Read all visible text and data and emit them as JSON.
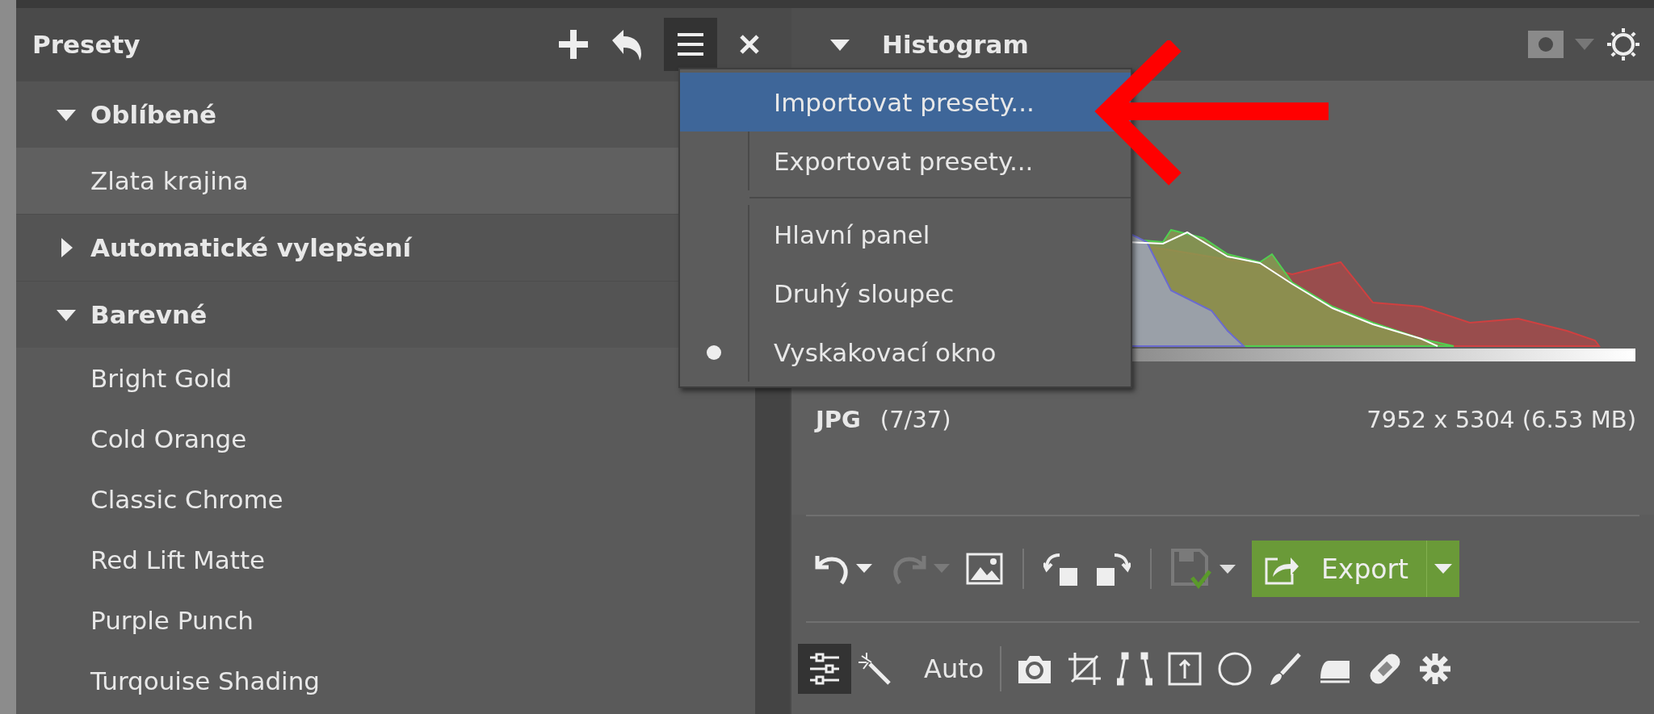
{
  "presets_panel": {
    "title": "Presety",
    "tree": [
      {
        "label": "Oblíbené",
        "expanded": true,
        "children": [
          {
            "label": "Zlata krajina"
          }
        ]
      },
      {
        "label": "Automatické vylepšení",
        "expanded": false
      },
      {
        "label": "Barevné",
        "expanded": true,
        "children": [
          {
            "label": "Bright Gold"
          },
          {
            "label": "Cold Orange"
          },
          {
            "label": "Classic Chrome"
          },
          {
            "label": "Red Lift Matte"
          },
          {
            "label": "Purple Punch"
          },
          {
            "label": "Turqouise Shading"
          }
        ]
      }
    ]
  },
  "menu": {
    "open": true,
    "groups": [
      [
        {
          "label": "Importovat presety...",
          "highlighted": true,
          "selected": false
        },
        {
          "label": "Exportovat presety...",
          "highlighted": false,
          "selected": false
        }
      ],
      [
        {
          "label": "Hlavní panel",
          "highlighted": false,
          "selected": false
        },
        {
          "label": "Druhý sloupec",
          "highlighted": false,
          "selected": false
        },
        {
          "label": "Vyskakovací okno",
          "highlighted": false,
          "selected": true
        }
      ]
    ]
  },
  "histogram_panel": {
    "title": "Histogram",
    "expanded": true,
    "format": "JPG",
    "position": "(7/37)",
    "dimensions": "7952 x 5304 (6.53 MB)"
  },
  "toolbar": [
    {
      "kind": "undo",
      "disabled": false
    },
    {
      "kind": "redo",
      "disabled": true
    },
    {
      "kind": "image",
      "disabled": false
    },
    {
      "kind": "rotate-left",
      "disabled": false
    },
    {
      "kind": "rotate-right",
      "disabled": false
    },
    {
      "kind": "save",
      "disabled": true
    }
  ],
  "export_button": {
    "label": "Export"
  },
  "tools": {
    "auto_label": "Auto",
    "items": [
      {
        "kind": "adjust",
        "selected": true
      },
      {
        "kind": "wand",
        "selected": false
      },
      {
        "kind": "camera",
        "selected": false
      },
      {
        "kind": "crop",
        "selected": false
      },
      {
        "kind": "perspective",
        "selected": false
      },
      {
        "kind": "upload",
        "selected": false
      },
      {
        "kind": "circle",
        "selected": false
      },
      {
        "kind": "brush",
        "selected": false
      },
      {
        "kind": "iron",
        "selected": false
      },
      {
        "kind": "bandage",
        "selected": false
      },
      {
        "kind": "gear",
        "selected": false
      }
    ]
  }
}
